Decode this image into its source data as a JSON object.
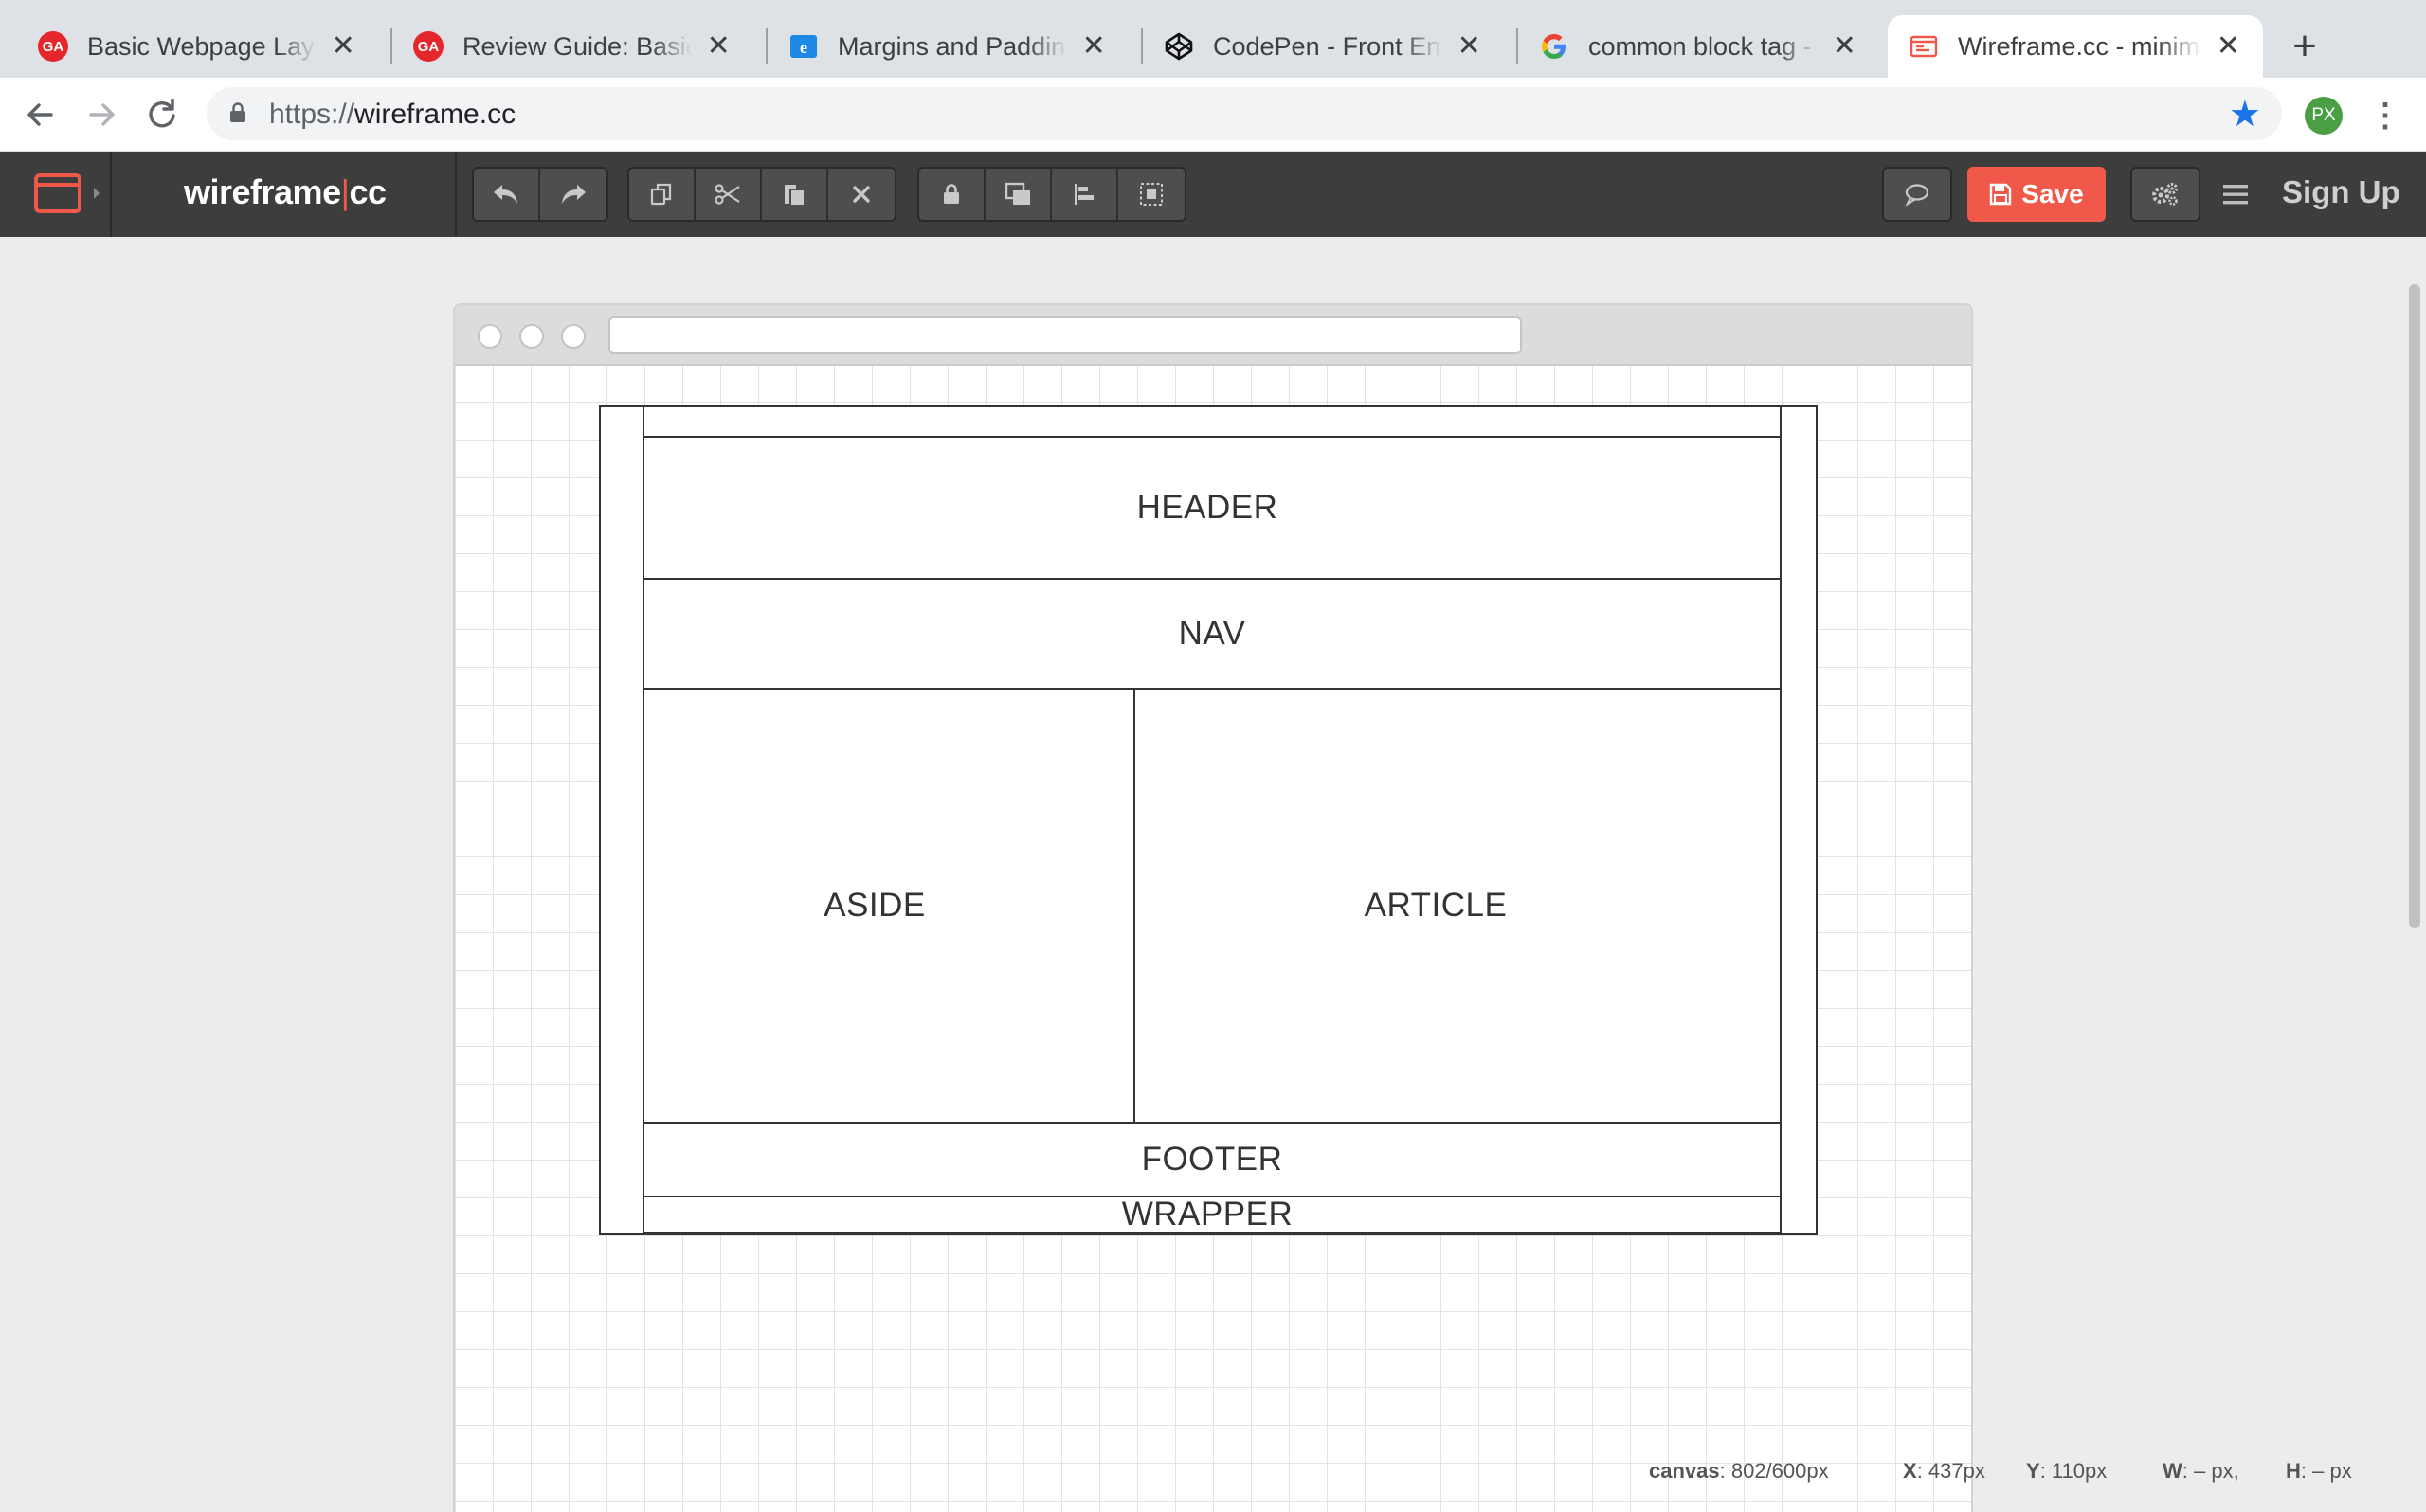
{
  "browser": {
    "tabs": [
      {
        "title": "Basic Webpage Layout",
        "favicon": "ga-logo-icon",
        "favicon_text": "GA",
        "favicon_color": "#e4262d"
      },
      {
        "title": "Review Guide: Basic Webpage",
        "favicon": "ga-logo-icon",
        "favicon_text": "GA",
        "favicon_color": "#e4262d"
      },
      {
        "title": "Margins and Padding | Internet",
        "favicon": "ie-logo-icon"
      },
      {
        "title": "CodePen - Front End Developer",
        "favicon": "codepen-logo-icon"
      },
      {
        "title": "common block tag - Google",
        "favicon": "google-logo-icon"
      },
      {
        "title": "Wireframe.cc - minimal",
        "favicon": "wireframe-logo-icon",
        "active": true
      }
    ],
    "url_scheme": "https://",
    "url_host": "wireframe.cc",
    "profile_initials": "PX"
  },
  "app": {
    "logo_main": "wireframe",
    "logo_sep": "|",
    "logo_suffix": "cc",
    "save_label": "Save",
    "signup_label": "Sign Up",
    "accent_color": "#f0584a",
    "toolbar_groups": [
      [
        "undo-icon",
        "redo-icon"
      ],
      [
        "copy-icon",
        "cut-icon",
        "paste-icon",
        "delete-icon"
      ],
      [
        "lock-icon",
        "bring-to-front-icon",
        "align-icon",
        "group-icon"
      ]
    ]
  },
  "wireframe": {
    "header": "HEADER",
    "nav": "NAV",
    "aside": "ASIDE",
    "article": "ARTICLE",
    "footer": "FOOTER",
    "wrapper": "WRAPPER"
  },
  "status": {
    "canvas_label": "canvas",
    "canvas_value": ": 802/600px",
    "x_label": "X",
    "x_value": ": 437px",
    "y_label": "Y",
    "y_value": ": 110px",
    "w_label": "W",
    "w_value": ": – px,",
    "h_label": "H",
    "h_value": ": – px"
  }
}
